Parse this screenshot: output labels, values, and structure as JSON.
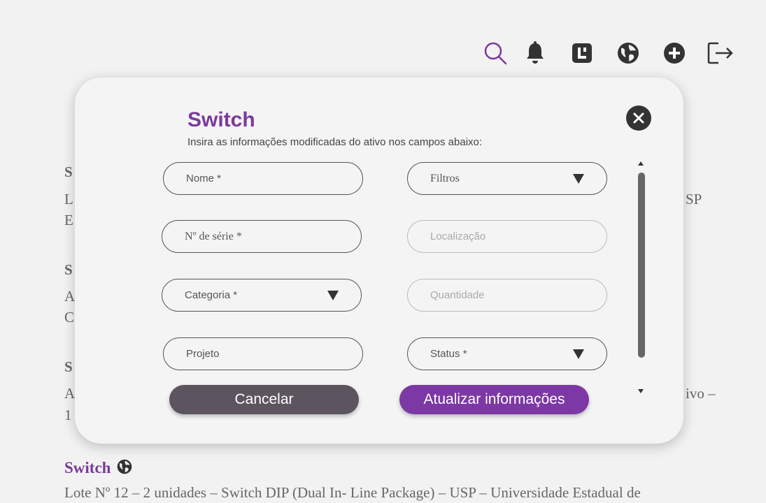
{
  "toolbar": {
    "icons": [
      "search-icon",
      "bell-icon",
      "panel-icon",
      "globe-icon",
      "add-icon",
      "logout-icon"
    ],
    "accent": "#7b3a9c"
  },
  "background": {
    "fragments": {
      "t1": "S",
      "l1a": "L",
      "l1b": "E",
      "r1": "SP",
      "t2": "S",
      "l2a": "A",
      "l2b": "C",
      "t3": "S",
      "l3a": "A",
      "l3b": "1",
      "r3": "ivo –"
    },
    "last_item": {
      "title": "Switch",
      "desc": "Lote Nº 12 – 2 unidades – Switch DIP (Dual In- Line Package) – USP – Universidade Estadual de"
    }
  },
  "modal": {
    "title": "Switch",
    "subtitle": "Insira as informações modificadas do ativo nos campos abaixo:",
    "fields": {
      "nome": "Nome *",
      "filtros": "Filtros",
      "serie": "Nº de série *",
      "localizacao": "Localização",
      "categoria": "Categoria *",
      "quantidade": "Quantidade",
      "projeto": "Projeto",
      "status": "Status *"
    },
    "buttons": {
      "cancel": "Cancelar",
      "update": "Atualizar informações"
    }
  },
  "colors": {
    "primary": "#7c38a4",
    "cancel": "#5c5560",
    "title": "#7b3a9c"
  }
}
